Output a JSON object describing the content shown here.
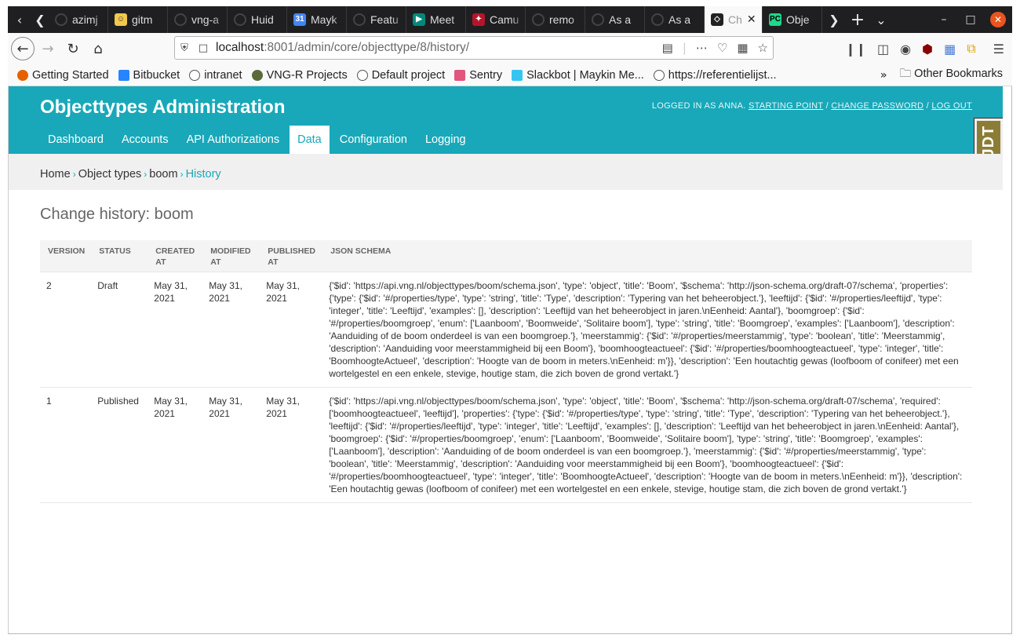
{
  "browser": {
    "tabs": [
      {
        "title": "azimj",
        "icon": "github-icon"
      },
      {
        "title": "gitm",
        "icon": "gitmoji-icon"
      },
      {
        "title": "vng-a",
        "icon": "github-icon"
      },
      {
        "title": "Huid",
        "icon": "github-icon"
      },
      {
        "title": "Mayk",
        "icon": "calendar-icon"
      },
      {
        "title": "Featu",
        "icon": "github-icon"
      },
      {
        "title": "Meet",
        "icon": "meet-icon"
      },
      {
        "title": "Camu",
        "icon": "camunda-icon"
      },
      {
        "title": "remo",
        "icon": "github-icon"
      },
      {
        "title": "As a",
        "icon": "github-icon"
      },
      {
        "title": "As a",
        "icon": "github-icon"
      }
    ],
    "active_tab": {
      "title": "Ch",
      "icon": "django-icon"
    },
    "last_tab": {
      "title": "Obje",
      "icon": "pycharm-icon"
    },
    "url": {
      "host": "localhost",
      "rest": ":8001/admin/core/objecttype/8/history/"
    },
    "bookmarks": [
      {
        "label": "Getting Started",
        "icon": "firefox-icon",
        "color": "#e66000"
      },
      {
        "label": "Bitbucket",
        "icon": "bitbucket-icon",
        "color": "#2684ff"
      },
      {
        "label": "intranet",
        "icon": "globe-icon",
        "color": "#555555"
      },
      {
        "label": "VNG-R Projects",
        "icon": "gear-icon",
        "color": "#5a6a3a"
      },
      {
        "label": "Default project",
        "icon": "globe-icon",
        "color": "#555555"
      },
      {
        "label": "Sentry",
        "icon": "sentry-icon",
        "color": "#e1567c"
      },
      {
        "label": "Slackbot | Maykin Me...",
        "icon": "slack-icon",
        "color": "#36c5f0"
      },
      {
        "label": "https://referentielijst...",
        "icon": "globe-icon",
        "color": "#555555"
      }
    ],
    "other_bookmarks": "Other Bookmarks"
  },
  "admin": {
    "site_title": "Objecttypes Administration",
    "user_tools": {
      "logged_in_as": "LOGGED IN AS",
      "username": "ANNA",
      "starting_point": "STARTING POINT",
      "change_password": "CHANGE PASSWORD",
      "log_out": "LOG OUT"
    },
    "nav": [
      "Dashboard",
      "Accounts",
      "API Authorizations",
      "Data",
      "Configuration",
      "Logging"
    ],
    "active_nav": "Data",
    "djdt_label": "DJDT",
    "breadcrumbs": [
      "Home",
      "Object types",
      "boom",
      "History"
    ],
    "page_title": "Change history: boom",
    "table": {
      "columns": [
        "VERSION",
        "STATUS",
        "CREATED AT",
        "MODIFIED AT",
        "PUBLISHED AT",
        "JSON SCHEMA"
      ],
      "rows": [
        {
          "version": "2",
          "status": "Draft",
          "created": "May 31, 2021",
          "modified": "May 31, 2021",
          "published": "May 31, 2021",
          "schema": "{'$id': 'https://api.vng.nl/objecttypes/boom/schema.json', 'type': 'object', 'title': 'Boom', '$schema': 'http://json-schema.org/draft-07/schema', 'properties': {'type': {'$id': '#/properties/type', 'type': 'string', 'title': 'Type', 'description': 'Typering van het beheerobject.'}, 'leeftijd': {'$id': '#/properties/leeftijd', 'type': 'integer', 'title': 'Leeftijd', 'examples': [], 'description': 'Leeftijd van het beheerobject in jaren.\\nEenheid: Aantal'}, 'boomgroep': {'$id': '#/properties/boomgroep', 'enum': ['Laanboom', 'Boomweide', 'Solitaire boom'], 'type': 'string', 'title': 'Boomgroep', 'examples': ['Laanboom'], 'description': 'Aanduiding of de boom onderdeel is van een boomgroep.'}, 'meerstammig': {'$id': '#/properties/meerstammig', 'type': 'boolean', 'title': 'Meerstammig', 'description': 'Aanduiding voor meerstammigheid bij een Boom'}, 'boomhoogteactueel': {'$id': '#/properties/boomhoogteactueel', 'type': 'integer', 'title': 'BoomhoogteActueel', 'description': 'Hoogte van de boom in meters.\\nEenheid: m'}}, 'description': 'Een houtachtig gewas (loofboom of conifeer) met een wortelgestel en een enkele, stevige, houtige stam, die zich boven de grond vertakt.'}"
        },
        {
          "version": "1",
          "status": "Published",
          "created": "May 31, 2021",
          "modified": "May 31, 2021",
          "published": "May 31, 2021",
          "schema": "{'$id': 'https://api.vng.nl/objecttypes/boom/schema.json', 'type': 'object', 'title': 'Boom', '$schema': 'http://json-schema.org/draft-07/schema', 'required': ['boomhoogteactueel', 'leeftijd'], 'properties': {'type': {'$id': '#/properties/type', 'type': 'string', 'title': 'Type', 'description': 'Typering van het beheerobject.'}, 'leeftijd': {'$id': '#/properties/leeftijd', 'type': 'integer', 'title': 'Leeftijd', 'examples': [], 'description': 'Leeftijd van het beheerobject in jaren.\\nEenheid: Aantal'}, 'boomgroep': {'$id': '#/properties/boomgroep', 'enum': ['Laanboom', 'Boomweide', 'Solitaire boom'], 'type': 'string', 'title': 'Boomgroep', 'examples': ['Laanboom'], 'description': 'Aanduiding of de boom onderdeel is van een boomgroep.'}, 'meerstammig': {'$id': '#/properties/meerstammig', 'type': 'boolean', 'title': 'Meerstammig', 'description': 'Aanduiding voor meerstammigheid bij een Boom'}, 'boomhoogteactueel': {'$id': '#/properties/boomhoogteactueel', 'type': 'integer', 'title': 'BoomhoogteActueel', 'description': 'Hoogte van de boom in meters.\\nEenheid: m'}}, 'description': 'Een houtachtig gewas (loofboom of conifeer) met een wortelgestel en een enkele, stevige, houtige stam, die zich boven de grond vertakt.'}"
        }
      ]
    }
  },
  "colors": {
    "accent": "#18a8b9",
    "breadcrumb_bg": "#f0f0f0",
    "tabbar_bg": "#1f1f22"
  }
}
